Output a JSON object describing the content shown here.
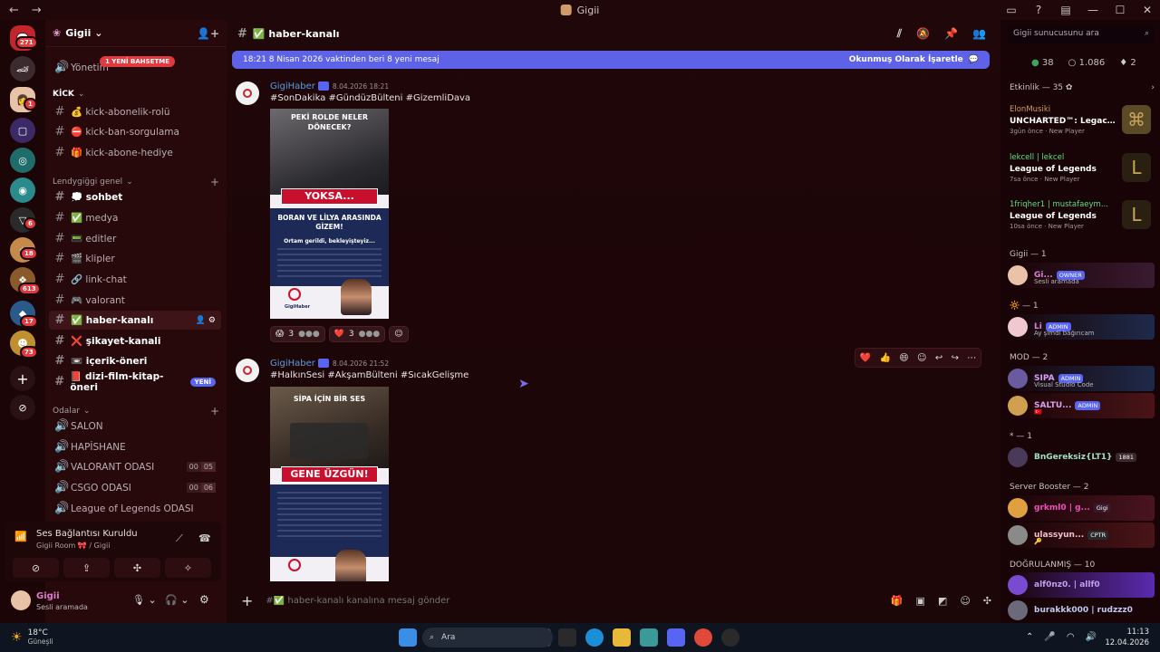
{
  "window": {
    "title": "Gigii"
  },
  "titlebar": {
    "back": "←",
    "forward": "→",
    "controls": [
      "▭",
      "?",
      "▤",
      "—",
      "☐",
      "✕"
    ]
  },
  "server": {
    "name": "Gigii ⌄",
    "folded_item": "Yönetim",
    "bahsetme_badge": "1 YENİ BAHSETME"
  },
  "rail_badges": [
    "271",
    "1",
    "6",
    "18",
    "613",
    "17",
    "73"
  ],
  "sidebar": {
    "cat_kick": "KİCK",
    "kick_channels": [
      "💰 kick-abonelik-rolü",
      "⛔ kick-ban-sorgulama",
      "🎁 kick-abone-hediye"
    ],
    "cat_general": "Lendygiğgi genel",
    "general_channels": [
      {
        "label": "💭 sohbet",
        "bold": true
      },
      {
        "label": "✅ medya",
        "bold": false
      },
      {
        "label": "📟 editler",
        "bold": false
      },
      {
        "label": "🎬 klipler",
        "bold": false
      },
      {
        "label": "🔗 link-chat",
        "bold": false
      },
      {
        "label": "🎮 valorant",
        "bold": false
      },
      {
        "label": "✅ haber-kanalı",
        "bold": true,
        "active": true
      },
      {
        "label": "❌ şikayet-kanali",
        "bold": true
      },
      {
        "label": "📼 içerik-öneri",
        "bold": true
      },
      {
        "label": "📕 dizi-film-kitap-öneri",
        "bold": true,
        "badge": "YENİ"
      }
    ],
    "cat_rooms": "Odalar",
    "voice_channels": [
      {
        "label": "SALON"
      },
      {
        "label": "HAPİSHANE"
      },
      {
        "label": "VALORANT ODASI",
        "count": "00",
        "limit": "05"
      },
      {
        "label": "CSGO ODASI",
        "count": "00",
        "limit": "06"
      },
      {
        "label": "League of Legends ODASI"
      }
    ],
    "voice": {
      "status": "Ses Bağlantısı Kuruldu",
      "room": "Gigii Room 🎀 / Gigii"
    },
    "user": {
      "name": "Gigii",
      "status": "Sesli aramada"
    }
  },
  "channel": {
    "name": "✅ haber-kanalı",
    "banner_text": "18:21 8 Nisan 2026 vaktinden beri 8 yeni mesaj",
    "banner_action": "Okunmuş Olarak İşaretle"
  },
  "messages": [
    {
      "author": "GigiHaber",
      "time": "8.04.2026 18:21",
      "text": "#SonDakika #GündüzBülteni #GizemliDava",
      "poster": {
        "headline": "PEKİ ROLDE NELER DÖNECEK?",
        "red": "YOKSA...",
        "sub": "BORAN VE LİLYA ARASINDA GİZEM!",
        "tagline": "Ortam gerildi, bekleyişteyiz...",
        "brand": "GigiHaber"
      },
      "reactions": [
        {
          "emoji": "😱",
          "count": "3"
        },
        {
          "emoji": "❤️",
          "count": "3"
        }
      ]
    },
    {
      "author": "GigiHaber",
      "time": "8.04.2026 21:52",
      "text": "#HalkınSesi #AkşamBülteni #SıcakGelişme",
      "poster": {
        "headline": "SİPA İÇİN BİR SES",
        "red": "GENE ÜZGÜN!",
        "brand": "GigiHaber"
      }
    }
  ],
  "composer": {
    "placeholder": "#✅ haber-kanalı kanalına mesaj gönder"
  },
  "members": {
    "search": "Gigii sunucusunu ara",
    "stats": {
      "online": "38",
      "total": "1.086",
      "boost": "2"
    },
    "activity_header": "Etkinlik — 35 ✿",
    "activities": [
      {
        "name": "ElonMusiki",
        "game": "UNCHARTED™: Legacy of ...",
        "time": "3gün önce",
        "tag": "New Player"
      },
      {
        "name": "lekcell | lekcel",
        "game": "League of Legends",
        "time": "7sa önce",
        "tag": "New Player"
      },
      {
        "name": "1friqher1 | mustafaeym...",
        "game": "League of Legends",
        "time": "10sa önce",
        "tag": "New Player"
      }
    ],
    "groups": [
      {
        "title": "Gigii — 1",
        "members": [
          {
            "name": "Gi...",
            "role": "OWNER",
            "sub": "Sesli aramada",
            "color": "#e080d8"
          }
        ]
      },
      {
        "title": "🔆 — 1",
        "members": [
          {
            "name": "Li",
            "role": "ADMIN",
            "sub": "Ay şimdi bağırıcam",
            "color": "#e080d8"
          }
        ]
      },
      {
        "title": "MOD — 2",
        "members": [
          {
            "name": "SIPA",
            "role": "ADMIN",
            "sub": "Visual Studio Code",
            "color": "#d9a0f0"
          },
          {
            "name": "SALTU...",
            "role": "ADMIN",
            "sub": "🇹🇷",
            "color": "#d9a0f0"
          }
        ]
      },
      {
        "title": "* — 1",
        "members": [
          {
            "name": "BnGereksiz{LT1}",
            "role": "1881",
            "sub": "",
            "color": "#9fe0c0"
          }
        ]
      },
      {
        "title": "Server Booster — 2",
        "members": [
          {
            "name": "grkml0 | g...",
            "role": "Gigi",
            "sub": "",
            "color": "#f04fc0"
          },
          {
            "name": "ulassyun...",
            "role": "CPTR",
            "sub": "🔑",
            "color": "#f0c0d0"
          }
        ]
      },
      {
        "title": "DOĞRULANMIŞ — 10",
        "members": [
          {
            "name": "alf0nz0. | allf0",
            "role": "",
            "sub": "",
            "color": "#c0a0f0"
          },
          {
            "name": "burakkk000 | rudzzz0",
            "role": "",
            "sub": "",
            "color": "#c0c8f0"
          }
        ]
      }
    ]
  },
  "taskbar": {
    "temp": "18°C",
    "weather": "Güneşli",
    "search": "Ara",
    "time": "11:13",
    "date": "12.04.2026"
  }
}
